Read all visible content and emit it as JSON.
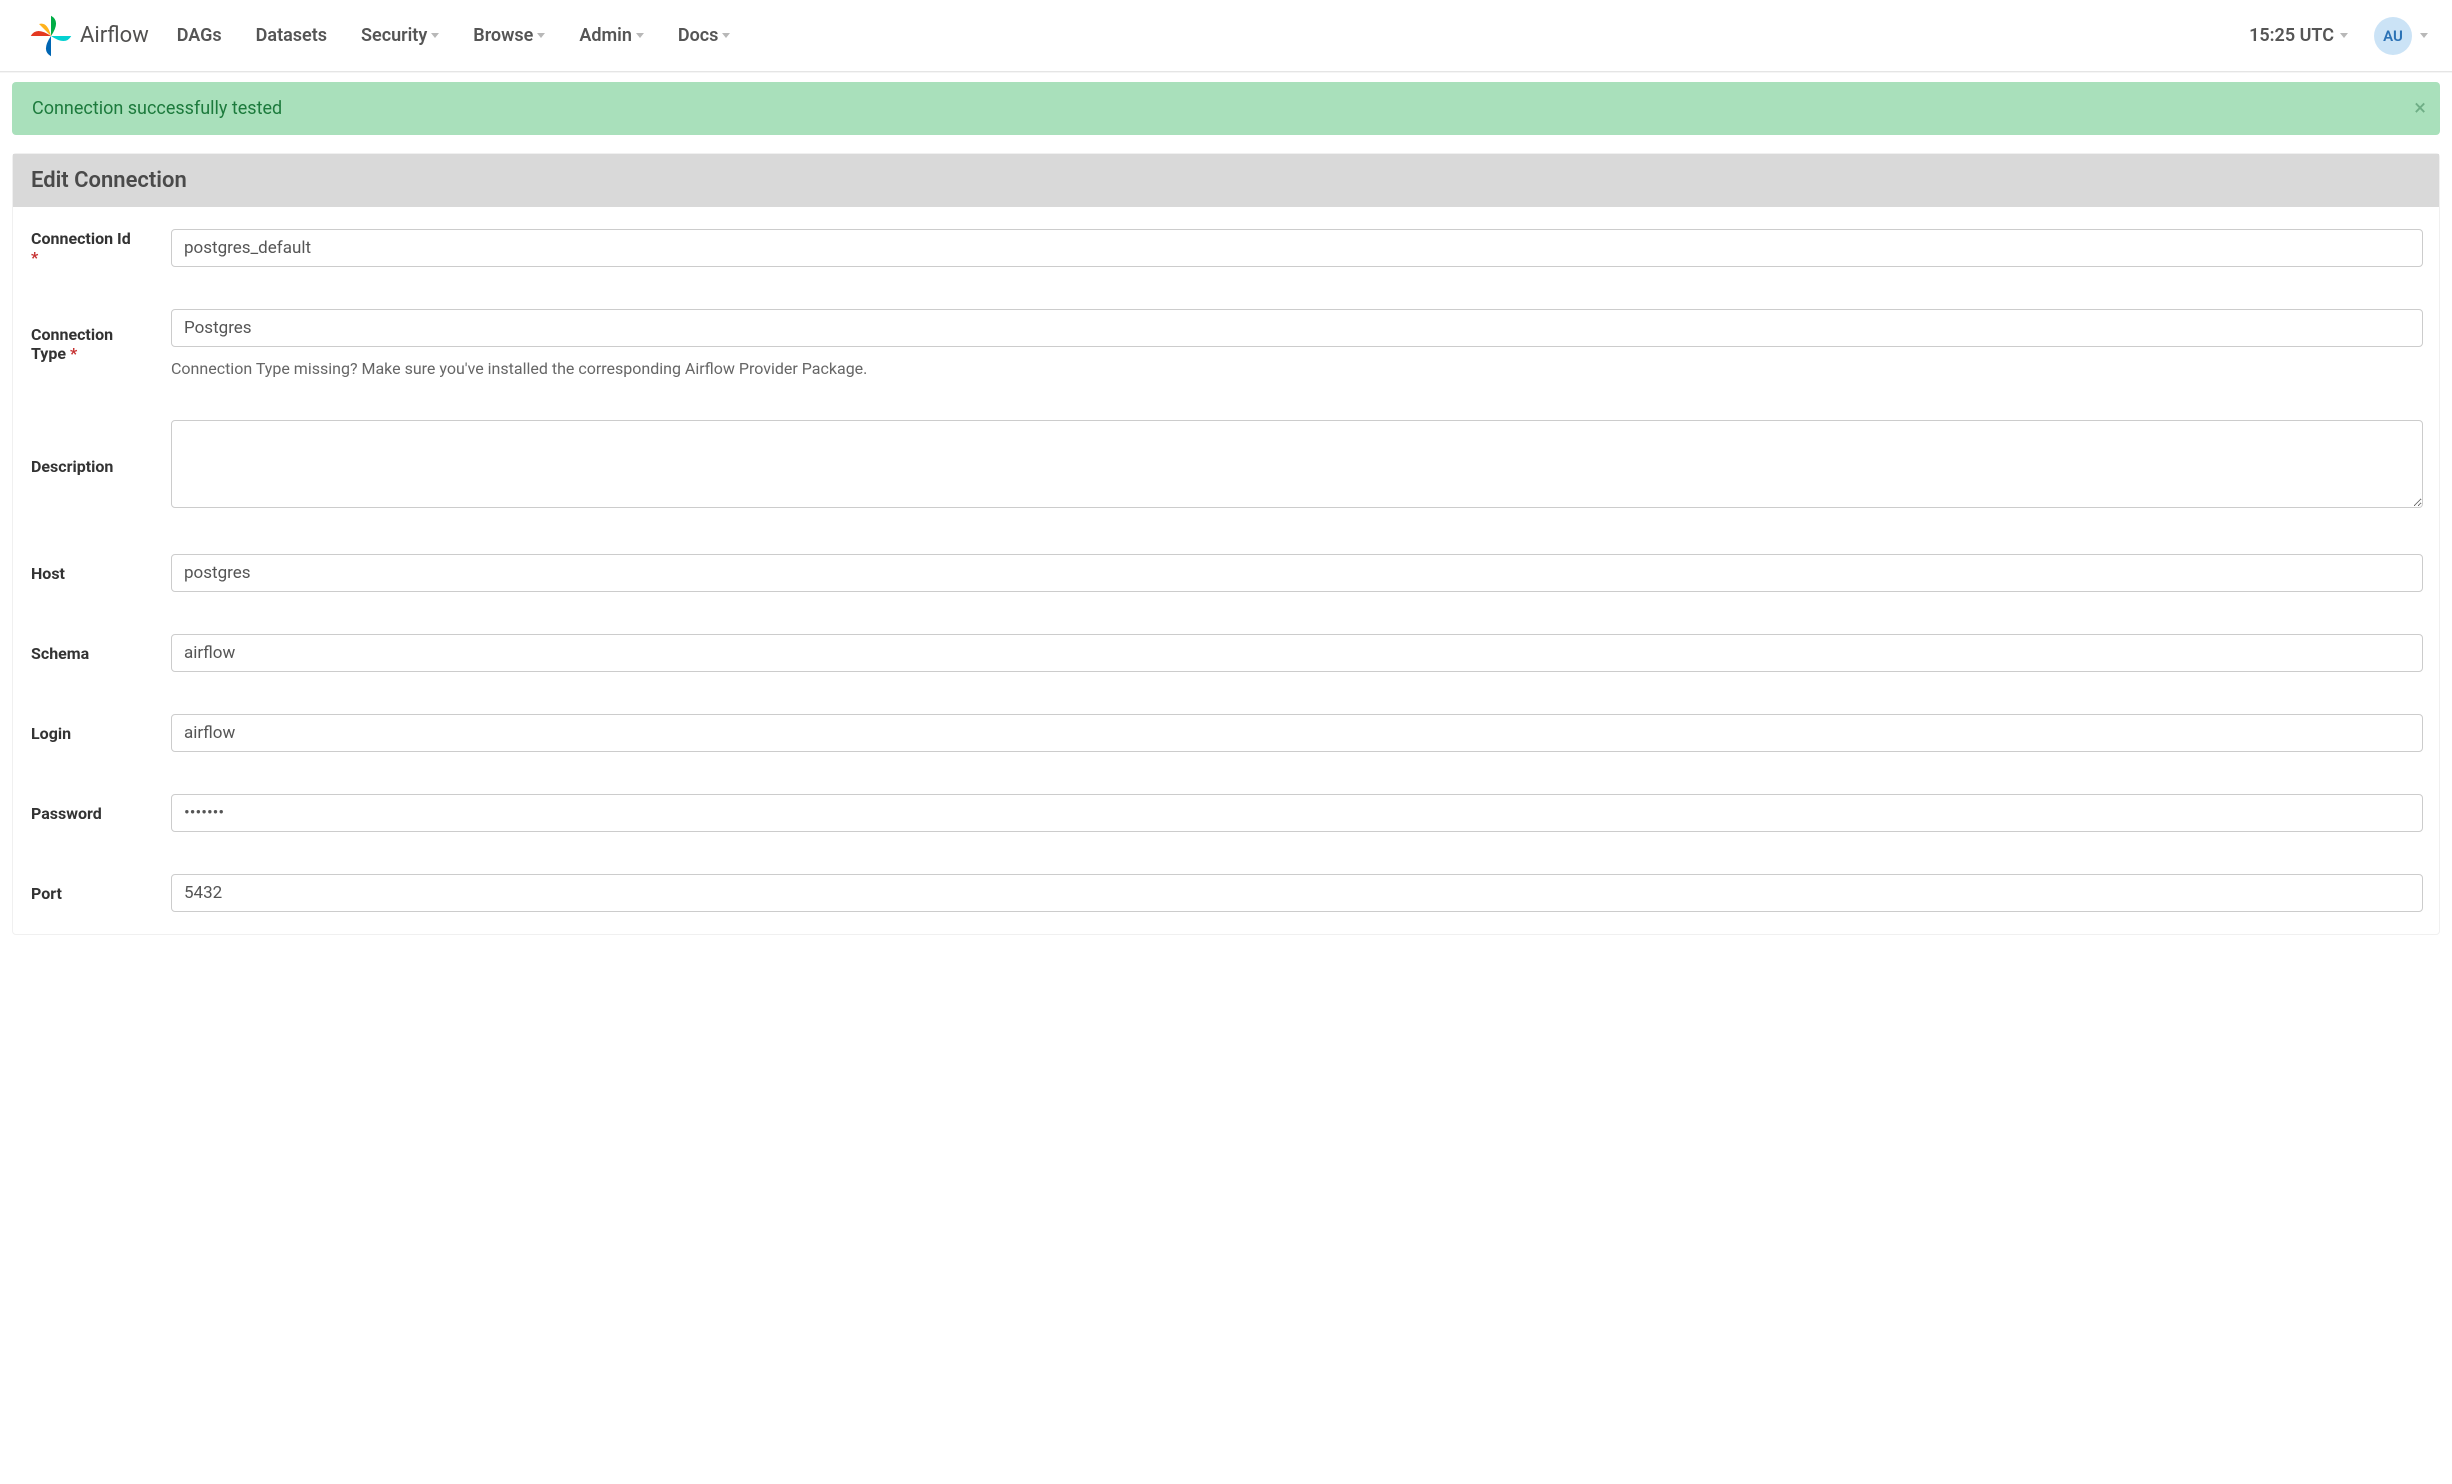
{
  "header": {
    "brand": "Airflow",
    "nav": [
      {
        "label": "DAGs",
        "dropdown": false
      },
      {
        "label": "Datasets",
        "dropdown": false
      },
      {
        "label": "Security",
        "dropdown": true
      },
      {
        "label": "Browse",
        "dropdown": true
      },
      {
        "label": "Admin",
        "dropdown": true
      },
      {
        "label": "Docs",
        "dropdown": true
      }
    ],
    "clock": "15:25 UTC",
    "user_initials": "AU"
  },
  "alert": {
    "text": "Connection successfully tested"
  },
  "panel": {
    "title": "Edit Connection"
  },
  "form": {
    "fields": {
      "conn_id": {
        "label": "Connection Id",
        "required": true,
        "value": "postgres_default"
      },
      "conn_type": {
        "label": "Connection Type",
        "required": true,
        "selected": "Postgres",
        "help": "Connection Type missing? Make sure you've installed the corresponding Airflow Provider Package."
      },
      "description": {
        "label": "Description",
        "required": false,
        "value": ""
      },
      "host": {
        "label": "Host",
        "required": false,
        "value": "postgres"
      },
      "schema": {
        "label": "Schema",
        "required": false,
        "value": "airflow"
      },
      "login": {
        "label": "Login",
        "required": false,
        "value": "airflow"
      },
      "password": {
        "label": "Password",
        "required": false,
        "value": "•••••••"
      },
      "port": {
        "label": "Port",
        "required": false,
        "value": "5432"
      }
    }
  }
}
